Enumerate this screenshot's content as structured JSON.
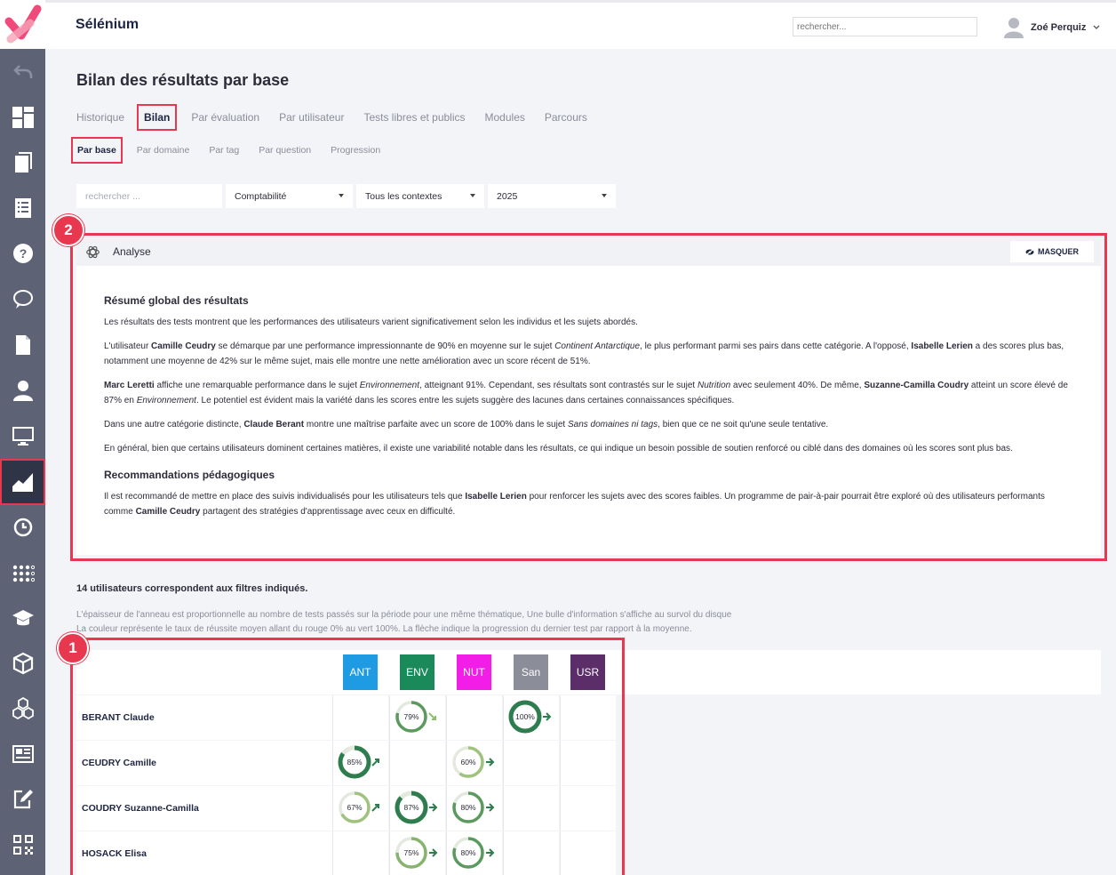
{
  "app": {
    "title": "Sélénium",
    "search_placeholder": "rechercher...",
    "user_name": "Zoé Perquiz"
  },
  "page": {
    "title": "Bilan des résultats par base"
  },
  "tabs": [
    {
      "label": "Historique"
    },
    {
      "label": "Bilan"
    },
    {
      "label": "Par évaluation"
    },
    {
      "label": "Par utilisateur"
    },
    {
      "label": "Tests libres et publics"
    },
    {
      "label": "Modules"
    },
    {
      "label": "Parcours"
    }
  ],
  "subtabs": [
    {
      "label": "Par base"
    },
    {
      "label": "Par domaine"
    },
    {
      "label": "Par tag"
    },
    {
      "label": "Par question"
    },
    {
      "label": "Progression"
    }
  ],
  "filters": {
    "search_placeholder": "rechercher ...",
    "base": "Comptabilité",
    "context": "Tous les contextes",
    "year": "2025"
  },
  "analyse": {
    "title": "Analyse",
    "hide_label": "MASQUER",
    "h1": "Résumé global des résultats",
    "p1": "Les résultats des tests montrent que les performances des utilisateurs varient significativement selon les individus et les sujets abordés.",
    "p2_a": "L'utilisateur ",
    "p2_b": "Camille Ceudry",
    "p2_c": " se démarque par une performance impressionnante de 90% en moyenne sur le sujet ",
    "p2_d": "Continent Antarctique",
    "p2_e": ", le plus performant parmi ses pairs dans cette catégorie. A l'opposé, ",
    "p2_f": "Isabelle Lerien",
    "p2_g": " a des scores plus bas, notamment une moyenne de 42% sur le même sujet, mais elle montre une nette amélioration avec un score récent de 51%.",
    "p3_a": "Marc Leretti",
    "p3_b": " affiche une remarquable performance dans le sujet ",
    "p3_c": "Environnement",
    "p3_d": ", atteignant 91%. Cependant, ses résultats sont contrastés sur le sujet ",
    "p3_e": "Nutrition",
    "p3_f": " avec seulement 40%. De même, ",
    "p3_g": "Suzanne-Camilla Coudry",
    "p3_h": " atteint un score élevé de 87% en ",
    "p3_i": "Environnement",
    "p3_j": ". Le potentiel est évident mais la variété dans les scores entre les sujets suggère des lacunes dans certaines connaissances spécifiques.",
    "p4_a": "Dans une autre catégorie distincte, ",
    "p4_b": "Claude Berant",
    "p4_c": " montre une maîtrise parfaite avec un score de 100% dans le sujet ",
    "p4_d": "Sans domaines ni tags",
    "p4_e": ", bien que ce ne soit qu'une seule tentative.",
    "p5": "En général, bien que certains utilisateurs dominent certaines matières, il existe une variabilité notable dans les résultats, ce qui indique un besoin possible de soutien renforcé ou ciblé dans des domaines où les scores sont plus bas.",
    "h2": "Recommandations pédagogiques",
    "p6_a": "Il est recommandé de mettre en place des suivis individualisés pour les utilisateurs tels que ",
    "p6_b": "Isabelle Lerien",
    "p6_c": " pour renforcer les sujets avec des scores faibles. Un programme de pair-à-pair pourrait être exploré où des utilisateurs performants comme ",
    "p6_d": "Camille Ceudry",
    "p6_e": " partagent des stratégies d'apprentissage avec ceux en difficulté."
  },
  "badges": {
    "one": "1",
    "two": "2"
  },
  "results": {
    "count_text": "14 utilisateurs correspondent aux filtres indiqués.",
    "legend_line1": "L'épaisseur de l'anneau est proportionnelle au nombre de tests passés sur la période pour une même thématique, Une bulle d'information s'affiche au survol du disque",
    "legend_line2": "La couleur représente le taux de réussite moyen allant du rouge 0% au vert 100%. La flèche indique la progression du dernier test par rapport à la moyenne.",
    "columns": [
      {
        "code": "ANT",
        "color": "#1e9be3"
      },
      {
        "code": "ENV",
        "color": "#1a8a5b"
      },
      {
        "code": "NUT",
        "color": "#f21ee8"
      },
      {
        "code": "San",
        "color": "#8b8d99"
      },
      {
        "code": "USR",
        "color": "#5b2e6a"
      }
    ],
    "rows": [
      {
        "name": "BERANT Claude",
        "cells": [
          null,
          {
            "pct": 79,
            "label": "79%",
            "dir": "down"
          },
          null,
          {
            "pct": 100,
            "label": "100%",
            "dir": "flat"
          },
          null
        ]
      },
      {
        "name": "CEUDRY Camille",
        "cells": [
          {
            "pct": 85,
            "label": "85%",
            "dir": "up"
          },
          null,
          {
            "pct": 60,
            "label": "60%",
            "dir": "flat"
          },
          null,
          null
        ]
      },
      {
        "name": "COUDRY Suzanne-Camilla",
        "cells": [
          {
            "pct": 67,
            "label": "67%",
            "dir": "up"
          },
          {
            "pct": 87,
            "label": "87%",
            "dir": "flat"
          },
          {
            "pct": 80,
            "label": "80%",
            "dir": "flat"
          },
          null,
          null
        ]
      },
      {
        "name": "HOSACK Elisa",
        "cells": [
          null,
          {
            "pct": 75,
            "label": "75%",
            "dir": "flat"
          },
          {
            "pct": 80,
            "label": "80%",
            "dir": "flat"
          },
          null,
          null
        ]
      }
    ]
  }
}
